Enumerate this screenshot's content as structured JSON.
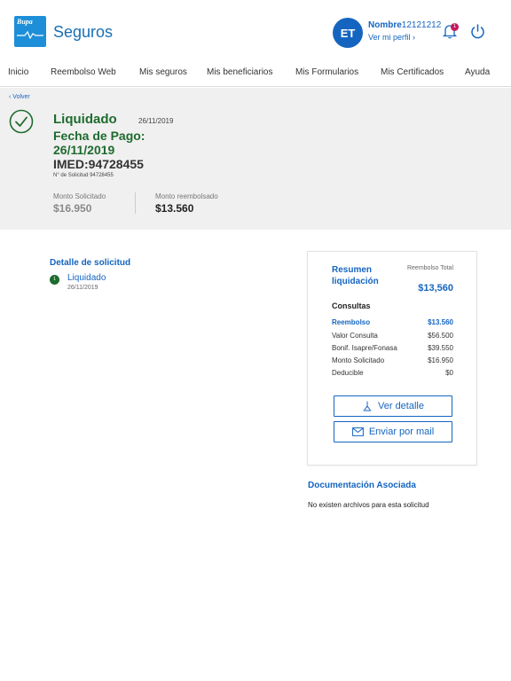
{
  "header": {
    "logo_text": "Bupa",
    "brand": "Seguros",
    "avatar_initials": "ET",
    "user_name_label": "Nombre",
    "user_name_value": "12121212",
    "profile_link": "Ver mi perfil",
    "notification_count": "1"
  },
  "nav": {
    "items": [
      "Inicio",
      "Reembolso Web",
      "Mis seguros",
      "Mis beneficiarios",
      "Mis Formularios",
      "Mis Certificados",
      "Ayuda"
    ]
  },
  "summary": {
    "back_label": "Volver",
    "status": "Liquidado",
    "status_date": "26/11/2019",
    "payment_label": "Fecha de Pago:",
    "payment_date": "26/11/2019",
    "imed": "IMED:94728455",
    "solicitud_number": "N° de Solicitud 94728455",
    "requested_label": "Monto Solicitado",
    "requested_value": "$16.950",
    "reimbursed_label": "Monto reembolsado",
    "reimbursed_value": "$13.560"
  },
  "detail": {
    "title": "Detalle de solicitud",
    "step_number": "1",
    "step_label": "Liquidado",
    "step_date": "26/11/2019"
  },
  "card": {
    "title": "Resumen liquidación",
    "total_label": "Reembolso Total",
    "total_value": "$13,560",
    "section": "Consultas",
    "rows": [
      {
        "label": "Reembolso",
        "value": "$13.560"
      },
      {
        "label": "Valor Consulta",
        "value": "$56.500"
      },
      {
        "label": "Bonif. Isapre/Fonasa",
        "value": "$39.550"
      },
      {
        "label": "Monto Solicitado",
        "value": "$16.950"
      },
      {
        "label": "Deducible",
        "value": "$0"
      }
    ],
    "detail_button": "Ver detalle",
    "mail_button": "Enviar por mail"
  },
  "docs": {
    "title": "Documentación Asociada",
    "empty": "No existen archivos para esta solicitud"
  },
  "colors": {
    "primary": "#1565c0",
    "success": "#1e6b2e",
    "band": "#f0f0f0",
    "badge": "#c2185b"
  }
}
